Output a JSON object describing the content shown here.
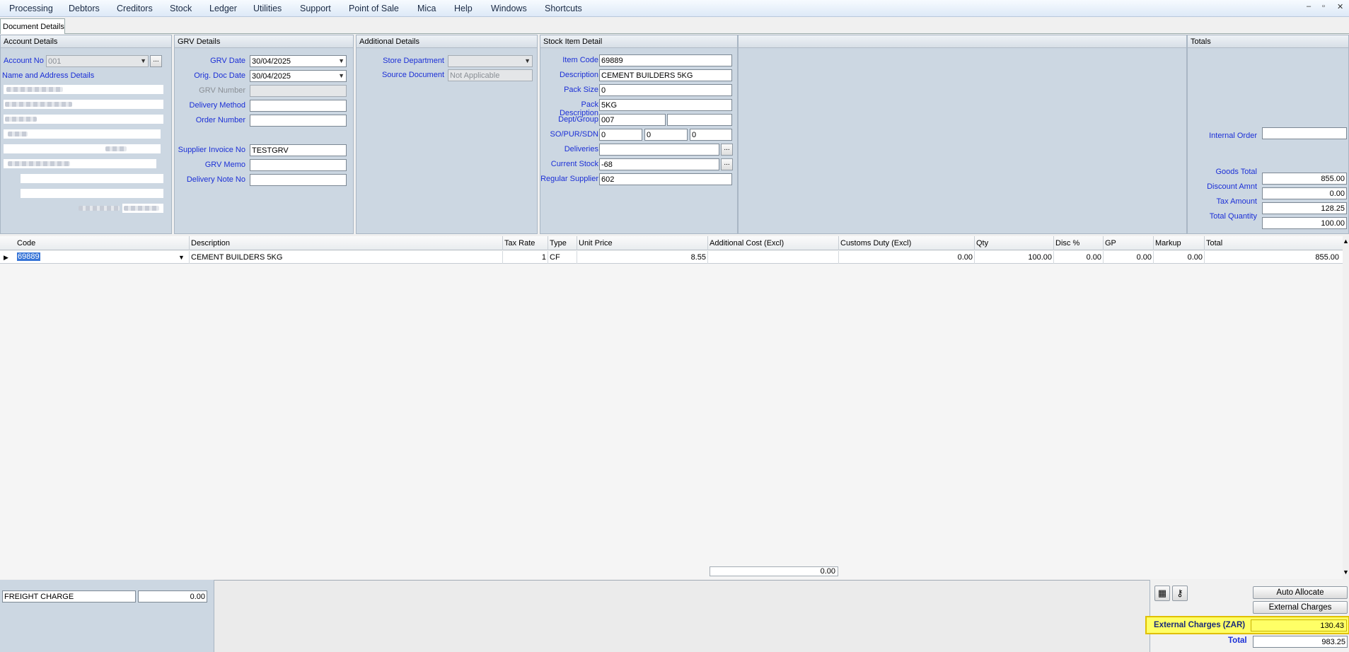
{
  "menu": [
    "Processing",
    "Debtors",
    "Creditors",
    "Stock",
    "Ledger",
    "Utilities",
    "Support",
    "Point of Sale",
    "Mica",
    "Help",
    "Windows",
    "Shortcuts"
  ],
  "window_controls": {
    "minimize": "–",
    "restore": "▫",
    "close": "✕"
  },
  "tab": {
    "label": "Document Details"
  },
  "account": {
    "header": "Account Details",
    "account_no_label": "Account No",
    "account_no": "001",
    "name_address_label": "Name and Address Details",
    "dots": "..."
  },
  "grv": {
    "header": "GRV Details",
    "grv_date_label": "GRV Date",
    "grv_date": "30/04/2025",
    "orig_doc_date_label": "Orig. Doc Date",
    "orig_doc_date": "30/04/2025",
    "grv_number_label": "GRV Number",
    "grv_number": "",
    "delivery_method_label": "Delivery Method",
    "delivery_method": "",
    "order_number_label": "Order Number",
    "order_number": "",
    "supplier_invoice_label": "Supplier Invoice No",
    "supplier_invoice": "TESTGRV",
    "grv_memo_label": "GRV Memo",
    "grv_memo": "",
    "delivery_note_label": "Delivery Note No",
    "delivery_note": ""
  },
  "additional": {
    "header": "Additional Details",
    "store_department_label": "Store Department",
    "store_department": "",
    "source_document_label": "Source Document",
    "source_document": "Not Applicable"
  },
  "stock": {
    "header": "Stock Item Detail",
    "item_code_label": "Item Code",
    "item_code": "69889",
    "description_label": "Description",
    "description": "CEMENT BUILDERS 5KG",
    "pack_size_label": "Pack Size",
    "pack_size": "0",
    "pack_description_label": "Pack Description",
    "pack_description": "5KG",
    "dept_group_label": "Dept/Group",
    "dept": "007",
    "group": "",
    "so_pur_sdn_label": "SO/PUR/SDN",
    "so": "0",
    "pur": "0",
    "sdn": "0",
    "deliveries_label": "Deliveries",
    "deliveries": "",
    "current_stock_label": "Current Stock",
    "current_stock": "-68",
    "regular_supplier_label": "Regular Supplier",
    "regular_supplier": "602",
    "dots": "..."
  },
  "totals": {
    "header": "Totals",
    "internal_order_label": "Internal Order",
    "internal_order": "",
    "goods_total_label": "Goods Total",
    "goods_total": "855.00",
    "discount_label": "Discount Amnt",
    "discount": "0.00",
    "tax_label": "Tax Amount",
    "tax": "128.25",
    "quantity_label": "Total Quantity",
    "quantity": "100.00"
  },
  "grid": {
    "columns": {
      "code": "Code",
      "description": "Description",
      "tax_rate": "Tax Rate",
      "type": "Type",
      "unit_price": "Unit Price",
      "additional_cost": "Additional Cost (Excl)",
      "customs_duty": "Customs Duty (Excl)",
      "qty": "Qty",
      "disc": "Disc %",
      "gp": "GP",
      "markup": "Markup",
      "total": "Total"
    },
    "row": {
      "code": "69889",
      "description": "CEMENT BUILDERS 5KG",
      "tax_rate": "1",
      "type": "CF",
      "unit_price": "8.55",
      "additional_cost": "",
      "customs_duty": "0.00",
      "qty": "100.00",
      "disc": "0.00",
      "gp": "0.00",
      "markup": "0.00",
      "total": "855.00"
    },
    "summary_value": "0.00"
  },
  "bottom": {
    "freight_label": "FREIGHT CHARGE",
    "freight_value": "0.00",
    "auto_allocate": "Auto Allocate",
    "external_charges_button": "External Charges",
    "external_charges_label": "External Charges (ZAR)",
    "external_charges_value": "130.43",
    "total_label": "Total",
    "total_value": "983.25"
  },
  "colors": {
    "label_blue": "#1b2fd6",
    "panel_bg": "#ccd7e2",
    "highlight": "#ffff66",
    "highlight_border": "#e0c000"
  }
}
